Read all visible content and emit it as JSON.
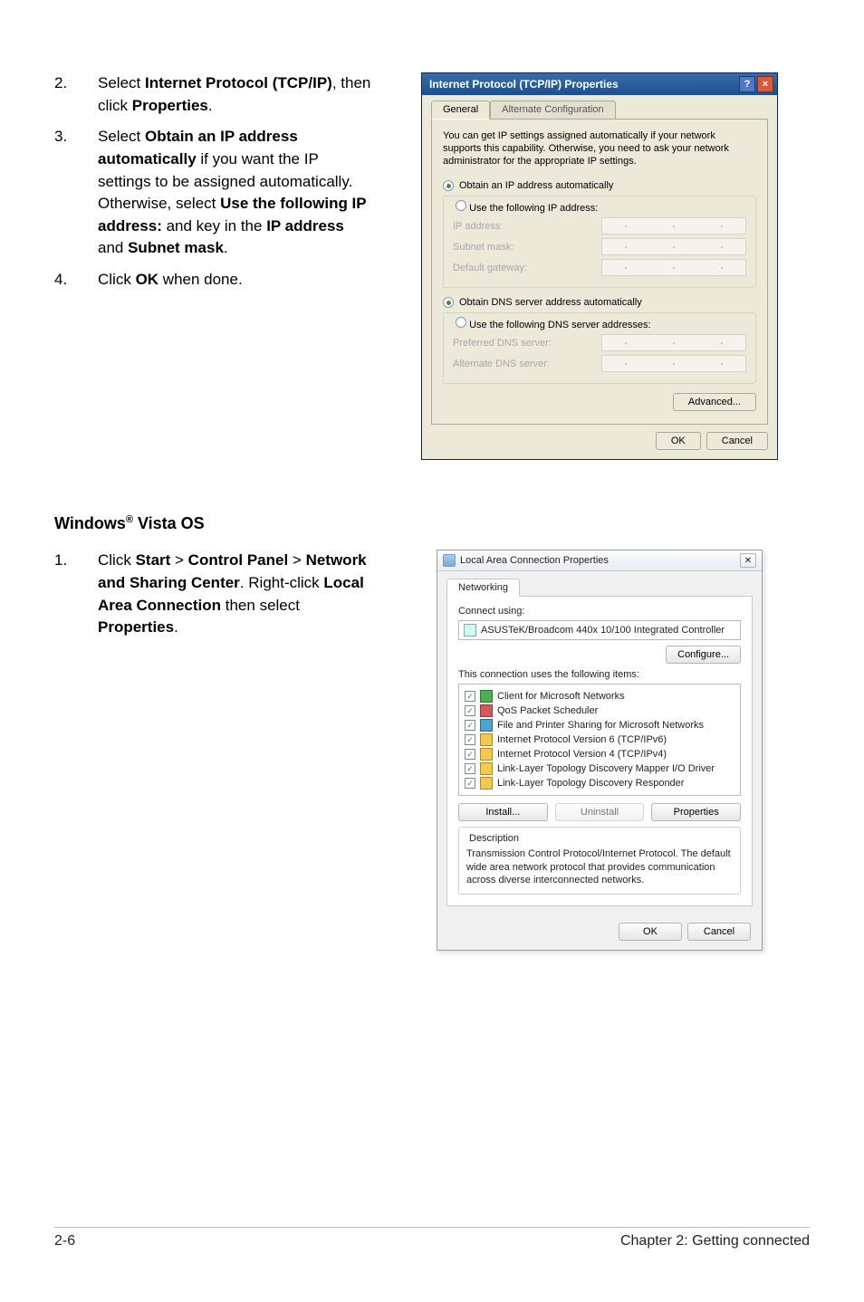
{
  "steps_top": [
    {
      "n": "2.",
      "parts": [
        "Select ",
        {
          "b": "Internet Protocol (TCP/IP)"
        },
        ", then click ",
        {
          "b": "Properties"
        },
        "."
      ]
    },
    {
      "n": "3.",
      "parts": [
        "Select ",
        {
          "b": "Obtain an IP address automatically"
        },
        " if you want the IP settings to be assigned automatically. Otherwise, select ",
        {
          "b": "Use the following IP address:"
        },
        " and key in the ",
        {
          "b": "IP address"
        },
        " and ",
        {
          "b": "Subnet mask"
        },
        "."
      ]
    },
    {
      "n": "4.",
      "parts": [
        "Click ",
        {
          "b": "OK"
        },
        " when done."
      ]
    }
  ],
  "windows_vista_title": "Windows® Vista OS",
  "steps_bottom": [
    {
      "n": "1.",
      "parts": [
        "Click ",
        {
          "b": "Start"
        },
        " > ",
        {
          "b": "Control Panel"
        },
        " > ",
        {
          "b": "Network and Sharing Center"
        },
        ". Right-click ",
        {
          "b": "Local Area Connection"
        },
        " then select ",
        {
          "b": "Properties"
        },
        "."
      ]
    }
  ],
  "xp": {
    "title": "Internet Protocol (TCP/IP) Properties",
    "tab_general": "General",
    "tab_alt": "Alternate Configuration",
    "desc": "You can get IP settings assigned automatically if your network supports this capability. Otherwise, you need to ask your network administrator for the appropriate IP settings.",
    "radio_auto": "Obtain an IP address automatically",
    "radio_manual": "Use the following IP address:",
    "ip_address": "IP address:",
    "subnet": "Subnet mask:",
    "gateway": "Default gateway:",
    "dns_auto": "Obtain DNS server address automatically",
    "dns_manual": "Use the following DNS server addresses:",
    "dns_pref": "Preferred DNS server:",
    "dns_alt": "Alternate DNS server:",
    "advanced": "Advanced...",
    "ok": "OK",
    "cancel": "Cancel"
  },
  "vista": {
    "title": "Local Area Connection Properties",
    "tab": "Networking",
    "connect_using": "Connect using:",
    "adapter": "ASUSTeK/Broadcom 440x 10/100 Integrated Controller",
    "configure": "Configure...",
    "uses_items": "This connection uses the following items:",
    "items": [
      {
        "icon": "vicon-1",
        "label": "Client for Microsoft Networks"
      },
      {
        "icon": "vicon-2",
        "label": "QoS Packet Scheduler"
      },
      {
        "icon": "vicon-3",
        "label": "File and Printer Sharing for Microsoft Networks"
      },
      {
        "icon": "vicon-4",
        "label": "Internet Protocol Version 6 (TCP/IPv6)"
      },
      {
        "icon": "vicon-4",
        "label": "Internet Protocol Version 4 (TCP/IPv4)"
      },
      {
        "icon": "vicon-4",
        "label": "Link-Layer Topology Discovery Mapper I/O Driver"
      },
      {
        "icon": "vicon-4",
        "label": "Link-Layer Topology Discovery Responder"
      }
    ],
    "install": "Install...",
    "uninstall": "Uninstall",
    "properties": "Properties",
    "desc_title": "Description",
    "desc_text": "Transmission Control Protocol/Internet Protocol. The default wide area network protocol that provides communication across diverse interconnected networks.",
    "ok": "OK",
    "cancel": "Cancel"
  },
  "footer": {
    "left": "2-6",
    "right": "Chapter 2:  Getting connected"
  }
}
